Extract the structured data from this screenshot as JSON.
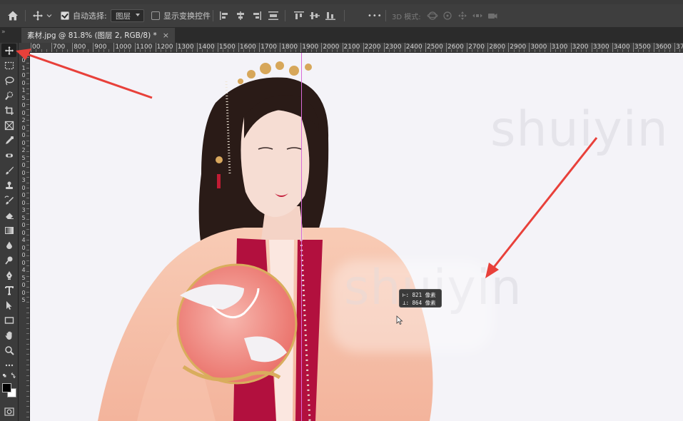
{
  "options_bar": {
    "auto_select_label": "自动选择:",
    "auto_select_checked": true,
    "auto_select_target": "图层",
    "show_transform_label": "显示变换控件",
    "show_transform_checked": false,
    "more_label": "•••",
    "mode_3d_label": "3D 模式:"
  },
  "document": {
    "panel_toggle": "»",
    "tab_title": "素材.jpg @ 81.8% (图层 2, RGB/8) *",
    "close_glyph": "×"
  },
  "ruler": {
    "top_labels": [
      "00",
      "700",
      "800",
      "900",
      "1000",
      "1100",
      "1200",
      "1300",
      "1400",
      "1500",
      "1600",
      "1700",
      "1800",
      "1900",
      "2000",
      "2100",
      "2200",
      "2300",
      "2400",
      "2500",
      "2600",
      "2700",
      "2800",
      "2900",
      "3000",
      "3100",
      "3200",
      "3300",
      "3400",
      "3500",
      "3600",
      "37"
    ],
    "left_labels": [
      "0",
      "1",
      "0",
      "0",
      "1",
      "5",
      "0",
      "0",
      "2",
      "0",
      "0",
      "0",
      "2",
      "5",
      "0",
      "0",
      "3",
      "0",
      "0",
      "0",
      "3",
      "5",
      "0",
      "0",
      "4",
      "0",
      "0",
      "0",
      "4",
      "5",
      "0",
      "0",
      "5"
    ]
  },
  "tools": [
    "move-tool",
    "marquee-tool",
    "lasso-tool",
    "quick-select-tool",
    "crop-tool",
    "frame-tool",
    "eyedropper-tool",
    "healing-brush-tool",
    "brush-tool",
    "clone-stamp-tool",
    "history-brush-tool",
    "eraser-tool",
    "gradient-tool",
    "blur-tool",
    "dodge-tool",
    "pen-tool",
    "type-tool",
    "path-select-tool",
    "rectangle-tool",
    "hand-tool",
    "zoom-tool",
    "edit-toolbar",
    "swap-colors",
    "color-swatches",
    "quick-mask"
  ],
  "colors": {
    "foreground": "#000000",
    "background": "#ffffff",
    "guide": "#d86bd8",
    "arrow": "#e8403a",
    "canvas_bg": "#f4f3f8"
  },
  "canvas": {
    "watermarks": [
      "shuiyin",
      "shuiyin"
    ],
    "coord_tooltip": {
      "line1": "⊢: 821 像素",
      "line2": "⊥: 864 像素"
    }
  }
}
